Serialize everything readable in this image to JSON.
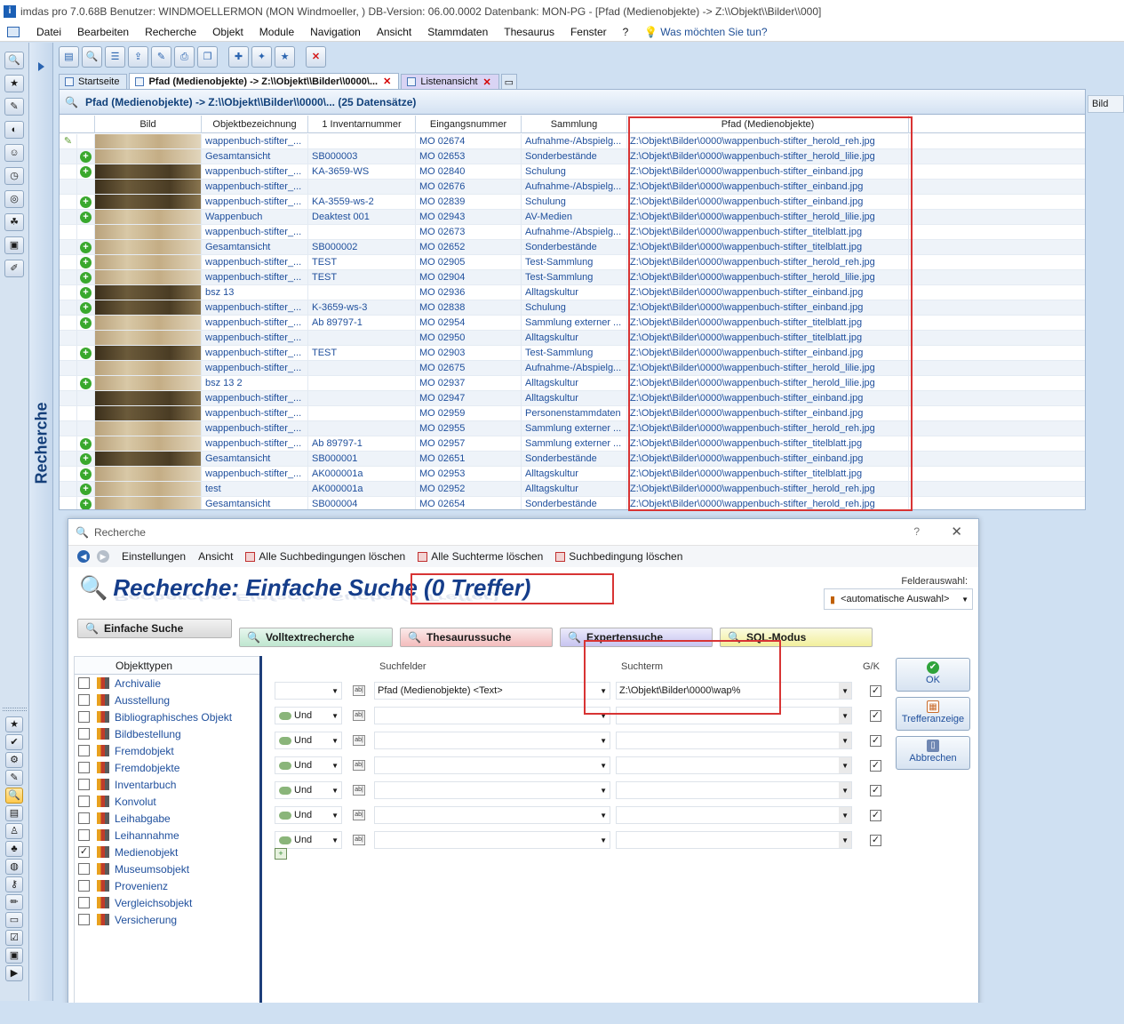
{
  "window": {
    "title": "imdas pro 7.0.68B Benutzer: WINDMOELLERMON (MON Windmoeller, )  DB-Version: 06.00.0002  Datenbank: MON-PG - [Pfad (Medienobjekte) -> Z:\\\\Objekt\\\\Bilder\\\\000]"
  },
  "menu": {
    "items": [
      "Datei",
      "Bearbeiten",
      "Recherche",
      "Objekt",
      "Module",
      "Navigation",
      "Ansicht",
      "Stammdaten",
      "Thesaurus",
      "Fenster",
      "?"
    ],
    "help_text": "Was möchten Sie tun?"
  },
  "sidebar": {
    "label": "Recherche"
  },
  "tabs": [
    {
      "label": "Startseite"
    },
    {
      "label": "Pfad (Medienobjekte) -> Z:\\\\Objekt\\\\Bilder\\\\0000\\..."
    },
    {
      "label": "Listenansicht"
    }
  ],
  "grid": {
    "header": "Pfad (Medienobjekte) -> Z:\\\\Objekt\\\\Bilder\\\\0000\\... (25 Datensätze)",
    "columns": [
      "Bild",
      "Objektbezeichnung",
      "1 Inventarnummer",
      "Eingangsnummer",
      "Sammlung",
      "Pfad (Medienobjekte)"
    ],
    "right_tab": "Bild",
    "rows": [
      {
        "plus": false,
        "thumb": "light",
        "obj": "wappenbuch-stifter_...",
        "inv": "",
        "ein": "MO 02674",
        "sam": "Aufnahme-/Abspielg...",
        "pfad": "Z:\\Objekt\\Bilder\\0000\\wappenbuch-stifter_herold_reh.jpg"
      },
      {
        "plus": true,
        "thumb": "light",
        "obj": "Gesamtansicht",
        "inv": "SB000003",
        "ein": "MO 02653",
        "sam": "Sonderbestände",
        "pfad": "Z:\\Objekt\\Bilder\\0000\\wappenbuch-stifter_herold_lilie.jpg"
      },
      {
        "plus": true,
        "thumb": "dark",
        "obj": "wappenbuch-stifter_...",
        "inv": "KA-3659-WS",
        "ein": "MO 02840",
        "sam": "Schulung",
        "pfad": "Z:\\Objekt\\Bilder\\0000\\wappenbuch-stifter_einband.jpg"
      },
      {
        "plus": false,
        "thumb": "dark",
        "obj": "wappenbuch-stifter_...",
        "inv": "",
        "ein": "MO 02676",
        "sam": "Aufnahme-/Abspielg...",
        "pfad": "Z:\\Objekt\\Bilder\\0000\\wappenbuch-stifter_einband.jpg"
      },
      {
        "plus": true,
        "thumb": "dark",
        "obj": "wappenbuch-stifter_...",
        "inv": "KA-3559-ws-2",
        "ein": "MO 02839",
        "sam": "Schulung",
        "pfad": "Z:\\Objekt\\Bilder\\0000\\wappenbuch-stifter_einband.jpg"
      },
      {
        "plus": true,
        "thumb": "light",
        "obj": "Wappenbuch",
        "inv": "Deaktest 001",
        "ein": "MO 02943",
        "sam": "AV-Medien",
        "pfad": "Z:\\Objekt\\Bilder\\0000\\wappenbuch-stifter_herold_lilie.jpg"
      },
      {
        "plus": false,
        "thumb": "light",
        "obj": "wappenbuch-stifter_...",
        "inv": "",
        "ein": "MO 02673",
        "sam": "Aufnahme-/Abspielg...",
        "pfad": "Z:\\Objekt\\Bilder\\0000\\wappenbuch-stifter_titelblatt.jpg"
      },
      {
        "plus": true,
        "thumb": "light",
        "obj": "Gesamtansicht",
        "inv": "SB000002",
        "ein": "MO 02652",
        "sam": "Sonderbestände",
        "pfad": "Z:\\Objekt\\Bilder\\0000\\wappenbuch-stifter_titelblatt.jpg"
      },
      {
        "plus": true,
        "thumb": "light",
        "obj": "wappenbuch-stifter_...",
        "inv": "TEST",
        "ein": "MO 02905",
        "sam": "Test-Sammlung",
        "pfad": "Z:\\Objekt\\Bilder\\0000\\wappenbuch-stifter_herold_reh.jpg"
      },
      {
        "plus": true,
        "thumb": "light",
        "obj": "wappenbuch-stifter_...",
        "inv": "TEST",
        "ein": "MO 02904",
        "sam": "Test-Sammlung",
        "pfad": "Z:\\Objekt\\Bilder\\0000\\wappenbuch-stifter_herold_lilie.jpg"
      },
      {
        "plus": true,
        "thumb": "dark",
        "obj": "bsz 13",
        "inv": "",
        "ein": "MO 02936",
        "sam": "Alltagskultur",
        "pfad": "Z:\\Objekt\\Bilder\\0000\\wappenbuch-stifter_einband.jpg"
      },
      {
        "plus": true,
        "thumb": "dark",
        "obj": "wappenbuch-stifter_...",
        "inv": "K-3659-ws-3",
        "ein": "MO 02838",
        "sam": "Schulung",
        "pfad": "Z:\\Objekt\\Bilder\\0000\\wappenbuch-stifter_einband.jpg"
      },
      {
        "plus": true,
        "thumb": "light",
        "obj": "wappenbuch-stifter_...",
        "inv": "Ab 89797-1",
        "ein": "MO 02954",
        "sam": "Sammlung externer ...",
        "pfad": "Z:\\Objekt\\Bilder\\0000\\wappenbuch-stifter_titelblatt.jpg"
      },
      {
        "plus": false,
        "thumb": "light",
        "obj": "wappenbuch-stifter_...",
        "inv": "",
        "ein": "MO 02950",
        "sam": "Alltagskultur",
        "pfad": "Z:\\Objekt\\Bilder\\0000\\wappenbuch-stifter_titelblatt.jpg"
      },
      {
        "plus": true,
        "thumb": "dark",
        "obj": "wappenbuch-stifter_...",
        "inv": "TEST",
        "ein": "MO 02903",
        "sam": "Test-Sammlung",
        "pfad": "Z:\\Objekt\\Bilder\\0000\\wappenbuch-stifter_einband.jpg"
      },
      {
        "plus": false,
        "thumb": "light",
        "obj": "wappenbuch-stifter_...",
        "inv": "",
        "ein": "MO 02675",
        "sam": "Aufnahme-/Abspielg...",
        "pfad": "Z:\\Objekt\\Bilder\\0000\\wappenbuch-stifter_herold_lilie.jpg"
      },
      {
        "plus": true,
        "thumb": "light",
        "obj": "bsz 13 2",
        "inv": "",
        "ein": "MO 02937",
        "sam": "Alltagskultur",
        "pfad": "Z:\\Objekt\\Bilder\\0000\\wappenbuch-stifter_herold_lilie.jpg"
      },
      {
        "plus": false,
        "thumb": "dark",
        "obj": "wappenbuch-stifter_...",
        "inv": "",
        "ein": "MO 02947",
        "sam": "Alltagskultur",
        "pfad": "Z:\\Objekt\\Bilder\\0000\\wappenbuch-stifter_einband.jpg"
      },
      {
        "plus": false,
        "thumb": "dark",
        "obj": "wappenbuch-stifter_...",
        "inv": "",
        "ein": "MO 02959",
        "sam": "Personenstammdaten",
        "pfad": "Z:\\Objekt\\Bilder\\0000\\wappenbuch-stifter_einband.jpg"
      },
      {
        "plus": false,
        "thumb": "light",
        "obj": "wappenbuch-stifter_...",
        "inv": "",
        "ein": "MO 02955",
        "sam": "Sammlung externer ...",
        "pfad": "Z:\\Objekt\\Bilder\\0000\\wappenbuch-stifter_herold_reh.jpg"
      },
      {
        "plus": true,
        "thumb": "light",
        "obj": "wappenbuch-stifter_...",
        "inv": "Ab 89797-1",
        "ein": "MO 02957",
        "sam": "Sammlung externer ...",
        "pfad": "Z:\\Objekt\\Bilder\\0000\\wappenbuch-stifter_titelblatt.jpg"
      },
      {
        "plus": true,
        "thumb": "dark",
        "obj": "Gesamtansicht",
        "inv": "SB000001",
        "ein": "MO 02651",
        "sam": "Sonderbestände",
        "pfad": "Z:\\Objekt\\Bilder\\0000\\wappenbuch-stifter_einband.jpg"
      },
      {
        "plus": true,
        "thumb": "light",
        "obj": "wappenbuch-stifter_...",
        "inv": "AK000001a",
        "ein": "MO 02953",
        "sam": "Alltagskultur",
        "pfad": "Z:\\Objekt\\Bilder\\0000\\wappenbuch-stifter_titelblatt.jpg"
      },
      {
        "plus": true,
        "thumb": "light",
        "obj": "test",
        "inv": "AK000001a",
        "ein": "MO 02952",
        "sam": "Alltagskultur",
        "pfad": "Z:\\Objekt\\Bilder\\0000\\wappenbuch-stifter_herold_reh.jpg"
      },
      {
        "plus": true,
        "thumb": "light",
        "obj": "Gesamtansicht",
        "inv": "SB000004",
        "ein": "MO 02654",
        "sam": "Sonderbestände",
        "pfad": "Z:\\Objekt\\Bilder\\0000\\wappenbuch-stifter_herold_reh.jpg"
      }
    ]
  },
  "dialog": {
    "title": "Recherche",
    "help": "?",
    "toolbar": [
      "Einstellungen",
      "Ansicht",
      "Alle Suchbedingungen löschen",
      "Alle Suchterme löschen",
      "Suchbedingung löschen"
    ],
    "heading": "Recherche: Einfache Suche (0 Treffer)",
    "felder_label": "Felderauswahl:",
    "felder_value": "<automatische Auswahl>",
    "modes": [
      "Einfache Suche",
      "Volltextrecherche",
      "Thesaurussuche",
      "Expertensuche",
      "SQL-Modus"
    ],
    "objekttypen_header": "Objekttypen",
    "objekttypen": [
      {
        "label": "Archivalie",
        "checked": false
      },
      {
        "label": "Ausstellung",
        "checked": false
      },
      {
        "label": "Bibliographisches Objekt",
        "checked": false
      },
      {
        "label": "Bildbestellung",
        "checked": false
      },
      {
        "label": "Fremdobjekt",
        "checked": false
      },
      {
        "label": "Fremdobjekte",
        "checked": false
      },
      {
        "label": "Inventarbuch",
        "checked": false
      },
      {
        "label": "Konvolut",
        "checked": false
      },
      {
        "label": "Leihabgabe",
        "checked": false
      },
      {
        "label": "Leihannahme",
        "checked": false
      },
      {
        "label": "Medienobjekt",
        "checked": true
      },
      {
        "label": "Museumsobjekt",
        "checked": false
      },
      {
        "label": "Provenienz",
        "checked": false
      },
      {
        "label": "Vergleichsobjekt",
        "checked": false
      },
      {
        "label": "Versicherung",
        "checked": false
      }
    ],
    "suchfelder_label": "Suchfelder",
    "suchterm_label": "Suchterm",
    "gk_label": "G/K",
    "criteria": [
      {
        "op": "",
        "field": "Pfad (Medienobjekte) <Text>",
        "term": "Z:\\Objekt\\Bilder\\0000\\wap%",
        "gk": true
      },
      {
        "op": "Und",
        "field": "",
        "term": "",
        "gk": true
      },
      {
        "op": "Und",
        "field": "",
        "term": "",
        "gk": true
      },
      {
        "op": "Und",
        "field": "",
        "term": "",
        "gk": true
      },
      {
        "op": "Und",
        "field": "",
        "term": "",
        "gk": true
      },
      {
        "op": "Und",
        "field": "",
        "term": "",
        "gk": true
      },
      {
        "op": "Und",
        "field": "",
        "term": "",
        "gk": true
      }
    ],
    "buttons": {
      "ok": "OK",
      "treffer": "Trefferanzeige",
      "abbrechen": "Abbrechen"
    }
  }
}
